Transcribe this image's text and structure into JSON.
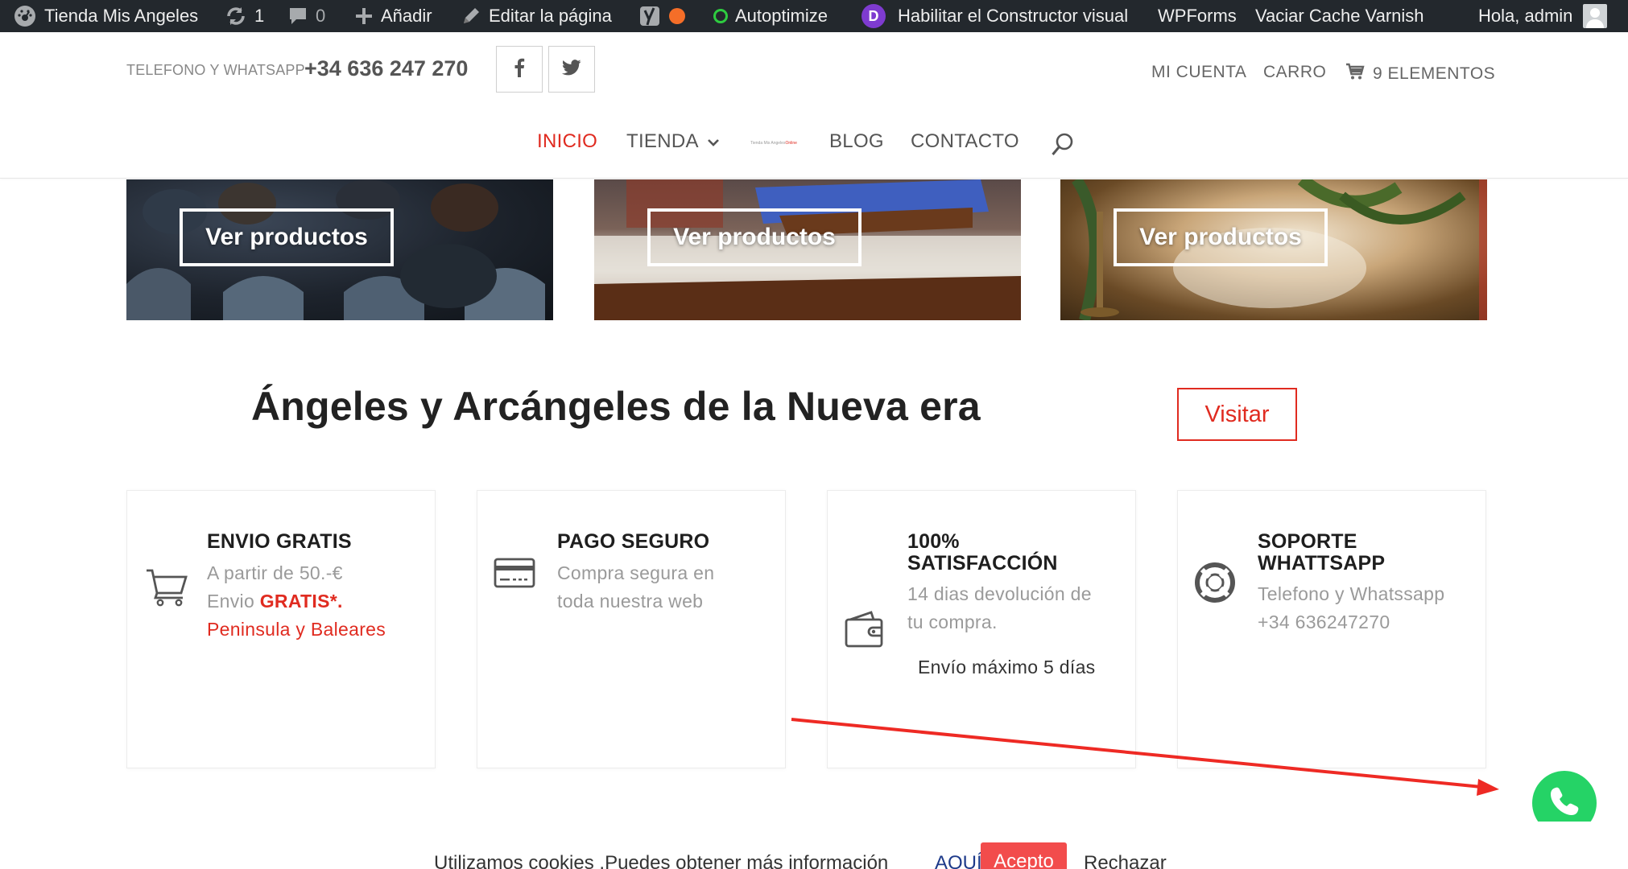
{
  "admin_bar": {
    "site_name": "Tienda Mis Angeles",
    "updates_count": "1",
    "comments_count": "0",
    "new_label": "Añadir",
    "edit_label": "Editar la página",
    "autoptimize_label": "Autoptimize",
    "divi_label": "Habilitar el Constructor visual",
    "divi_badge": "D",
    "wpforms_label": "WPForms",
    "varnish_label": "Vaciar Cache Varnish",
    "greeting": "Hola, admin"
  },
  "header": {
    "phone_label": "TELEFONO Y WHATSAPP",
    "phone_number": "+34 636 247 270",
    "account_label": "MI CUENTA",
    "cart_label": "CARRO",
    "cart_items": "9 ELEMENTOS"
  },
  "nav": {
    "items": [
      {
        "label": "INICIO",
        "active": true
      },
      {
        "label": "TIENDA",
        "has_dropdown": true
      },
      {
        "label": "BLOG"
      },
      {
        "label": "CONTACTO"
      }
    ],
    "logo_text_dark": "Tienda Mis Angeles",
    "logo_text_red": "Online"
  },
  "tiles": [
    {
      "button": "Ver productos"
    },
    {
      "button": "Ver productos"
    },
    {
      "button": "Ver productos"
    }
  ],
  "promo": {
    "heading": "Ángeles y Arcángeles de la Nueva era",
    "button": "Visitar"
  },
  "features": [
    {
      "icon": "cart-icon",
      "title": "ENVIO GRATIS",
      "line1": "A partir de  50.-€",
      "line2_prefix": "Envio ",
      "line2_highlight": "GRATIS*.",
      "line3": "Peninsula y Baleares"
    },
    {
      "icon": "credit-card-icon",
      "title": "PAGO SEGURO",
      "line1": "Compra segura en",
      "line2": "toda nuestra web"
    },
    {
      "icon": "wallet-icon",
      "title_line1": "100%",
      "title_line2": "SATISFACCIÓN",
      "line1": "14 dias devolución de",
      "line2": "tu compra.",
      "extra": "Envío máximo 5 días"
    },
    {
      "icon": "lifebuoy-icon",
      "title_line1": "SOPORTE",
      "title_line2": "WHATTSAPP",
      "line1": "Telefono y Whatssapp",
      "line2": "+34 636247270"
    }
  ],
  "cookie": {
    "text": "Utilizamos cookies .Puedes obtener más información",
    "link": "AQUÍ",
    "accept": "Acepto",
    "reject": "Rechazar"
  },
  "colors": {
    "accent_red": "#e02b20",
    "admin_bar_bg": "#23282d",
    "whatsapp_green": "#25d366",
    "annotation_red": "#ee2a24"
  }
}
